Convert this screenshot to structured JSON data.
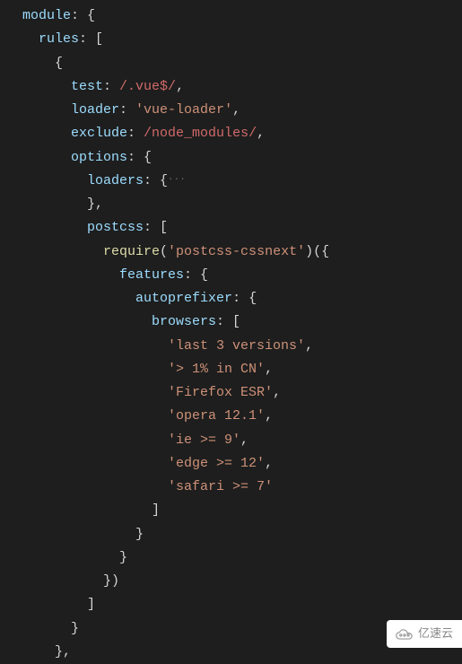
{
  "code": {
    "l1_key": "module",
    "l1_punct": ": {",
    "l2_key": "rules",
    "l2_punct": ": [",
    "l3": "{",
    "l4_key": "test",
    "l4_p1": ": ",
    "l4_regex": "/.vue$/",
    "l4_p2": ",",
    "l5_key": "loader",
    "l5_p1": ": ",
    "l5_str": "'vue-loader'",
    "l5_p2": ",",
    "l6_key": "exclude",
    "l6_p1": ": ",
    "l6_regex": "/node_modules/",
    "l6_p2": ",",
    "l7_key": "options",
    "l7_p1": ": {",
    "l8_key": "loaders",
    "l8_p1": ": {",
    "l8_ellipsis": "···",
    "l9": "},",
    "l10_key": "postcss",
    "l10_p1": ": [",
    "l11_func": "require",
    "l11_p1": "(",
    "l11_str": "'postcss-cssnext'",
    "l11_p2": ")({",
    "l12_key": "features",
    "l12_p1": ": {",
    "l13_key": "autoprefixer",
    "l13_p1": ": {",
    "l14_key": "browsers",
    "l14_p1": ": [",
    "l15_str": "'last 3 versions'",
    "l15_p1": ",",
    "l16_str": "'> 1% in CN'",
    "l16_p1": ",",
    "l17_str": "'Firefox ESR'",
    "l17_p1": ",",
    "l18_str": "'opera 12.1'",
    "l18_p1": ",",
    "l19_str": "'ie >= 9'",
    "l19_p1": ",",
    "l20_str": "'edge >= 12'",
    "l20_p1": ",",
    "l21_str": "'safari >= 7'",
    "l22": "]",
    "l23": "}",
    "l24": "}",
    "l25": "})",
    "l26": "]",
    "l27": "}",
    "l28": "},"
  },
  "watermark": "亿速云"
}
